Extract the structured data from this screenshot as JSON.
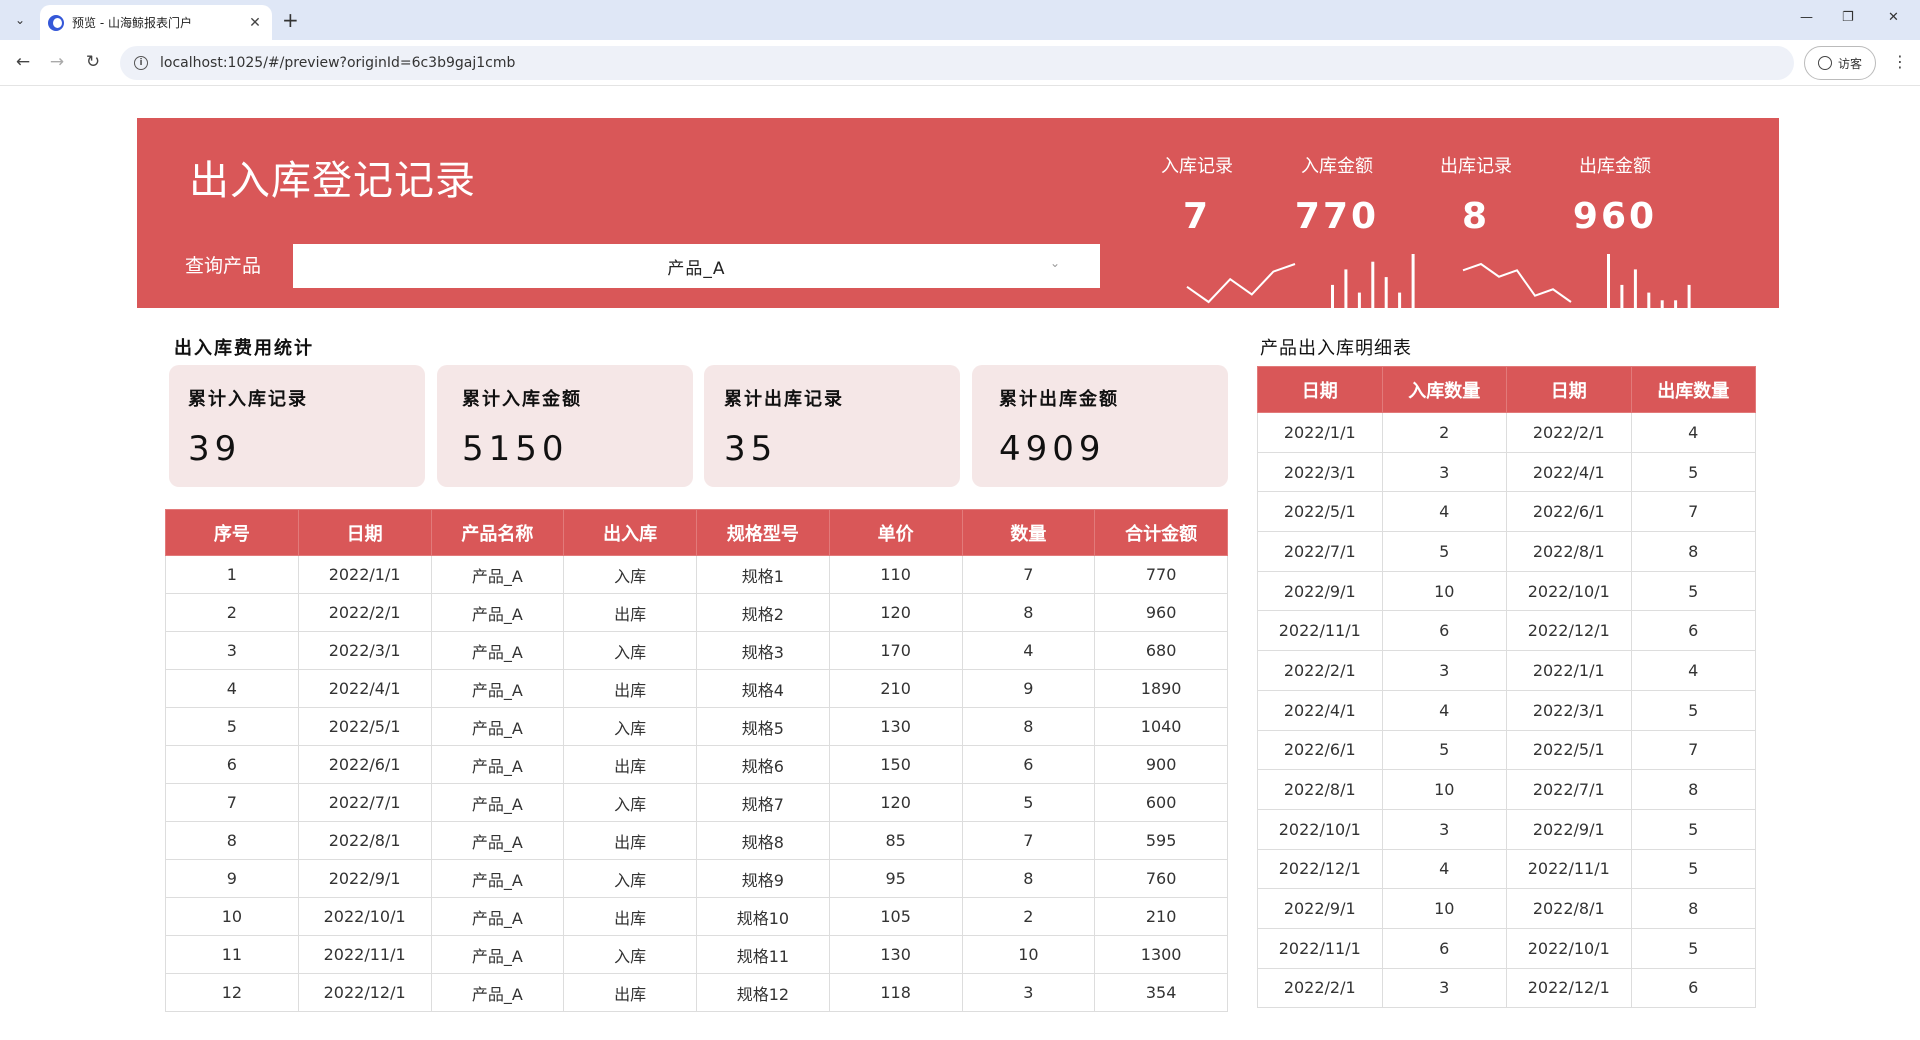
{
  "browser": {
    "tab_title": "预览 - 山海鲸报表门户",
    "url": "localhost:1025/#/preview?originId=6c3b9gaj1cmb",
    "profile_label": "访客"
  },
  "header": {
    "title": "出入库登记记录",
    "query_label": "查询产品",
    "selected_product": "产品_A",
    "kpis": [
      {
        "label": "入库记录",
        "value": "7"
      },
      {
        "label": "入库金额",
        "value": "770"
      },
      {
        "label": "出库记录",
        "value": "8"
      },
      {
        "label": "出库金额",
        "value": "960"
      }
    ]
  },
  "stats": {
    "title": "出入库费用统计",
    "cards": [
      {
        "label": "累计入库记录",
        "value": "39"
      },
      {
        "label": "累计入库金额",
        "value": "5150"
      },
      {
        "label": "累计出库记录",
        "value": "35"
      },
      {
        "label": "累计出库金额",
        "value": "4909"
      }
    ]
  },
  "main_table": {
    "headers": [
      "序号",
      "日期",
      "产品名称",
      "出入库",
      "规格型号",
      "单价",
      "数量",
      "合计金额"
    ],
    "rows": [
      [
        "1",
        "2022/1/1",
        "产品_A",
        "入库",
        "规格1",
        "110",
        "7",
        "770"
      ],
      [
        "2",
        "2022/2/1",
        "产品_A",
        "出库",
        "规格2",
        "120",
        "8",
        "960"
      ],
      [
        "3",
        "2022/3/1",
        "产品_A",
        "入库",
        "规格3",
        "170",
        "4",
        "680"
      ],
      [
        "4",
        "2022/4/1",
        "产品_A",
        "出库",
        "规格4",
        "210",
        "9",
        "1890"
      ],
      [
        "5",
        "2022/5/1",
        "产品_A",
        "入库",
        "规格5",
        "130",
        "8",
        "1040"
      ],
      [
        "6",
        "2022/6/1",
        "产品_A",
        "出库",
        "规格6",
        "150",
        "6",
        "900"
      ],
      [
        "7",
        "2022/7/1",
        "产品_A",
        "入库",
        "规格7",
        "120",
        "5",
        "600"
      ],
      [
        "8",
        "2022/8/1",
        "产品_A",
        "出库",
        "规格8",
        "85",
        "7",
        "595"
      ],
      [
        "9",
        "2022/9/1",
        "产品_A",
        "入库",
        "规格9",
        "95",
        "8",
        "760"
      ],
      [
        "10",
        "2022/10/1",
        "产品_A",
        "出库",
        "规格10",
        "105",
        "2",
        "210"
      ],
      [
        "11",
        "2022/11/1",
        "产品_A",
        "入库",
        "规格11",
        "130",
        "10",
        "1300"
      ],
      [
        "12",
        "2022/12/1",
        "产品_A",
        "出库",
        "规格12",
        "118",
        "3",
        "354"
      ]
    ]
  },
  "detail_table": {
    "title": "产品出入库明细表",
    "headers": [
      "日期",
      "入库数量",
      "日期",
      "出库数量"
    ],
    "rows": [
      [
        "2022/1/1",
        "2",
        "2022/2/1",
        "4"
      ],
      [
        "2022/3/1",
        "3",
        "2022/4/1",
        "5"
      ],
      [
        "2022/5/1",
        "4",
        "2022/6/1",
        "7"
      ],
      [
        "2022/7/1",
        "5",
        "2022/8/1",
        "8"
      ],
      [
        "2022/9/1",
        "10",
        "2022/10/1",
        "5"
      ],
      [
        "2022/11/1",
        "6",
        "2022/12/1",
        "6"
      ],
      [
        "2022/2/1",
        "3",
        "2022/1/1",
        "4"
      ],
      [
        "2022/4/1",
        "4",
        "2022/3/1",
        "5"
      ],
      [
        "2022/6/1",
        "5",
        "2022/5/1",
        "7"
      ],
      [
        "2022/8/1",
        "10",
        "2022/7/1",
        "8"
      ],
      [
        "2022/10/1",
        "3",
        "2022/9/1",
        "5"
      ],
      [
        "2022/12/1",
        "4",
        "2022/11/1",
        "5"
      ],
      [
        "2022/9/1",
        "10",
        "2022/8/1",
        "8"
      ],
      [
        "2022/11/1",
        "6",
        "2022/10/1",
        "5"
      ],
      [
        "2022/2/1",
        "3",
        "2022/12/1",
        "6"
      ]
    ]
  },
  "sparklines": {
    "in_records": [
      3,
      1,
      4,
      2,
      5,
      6
    ],
    "in_amount": [
      3,
      5,
      2,
      6,
      4,
      2,
      7
    ],
    "out_records": [
      6,
      7,
      5,
      6,
      2,
      3,
      1
    ],
    "out_amount": [
      7,
      3,
      5,
      2,
      1,
      1,
      3
    ]
  }
}
